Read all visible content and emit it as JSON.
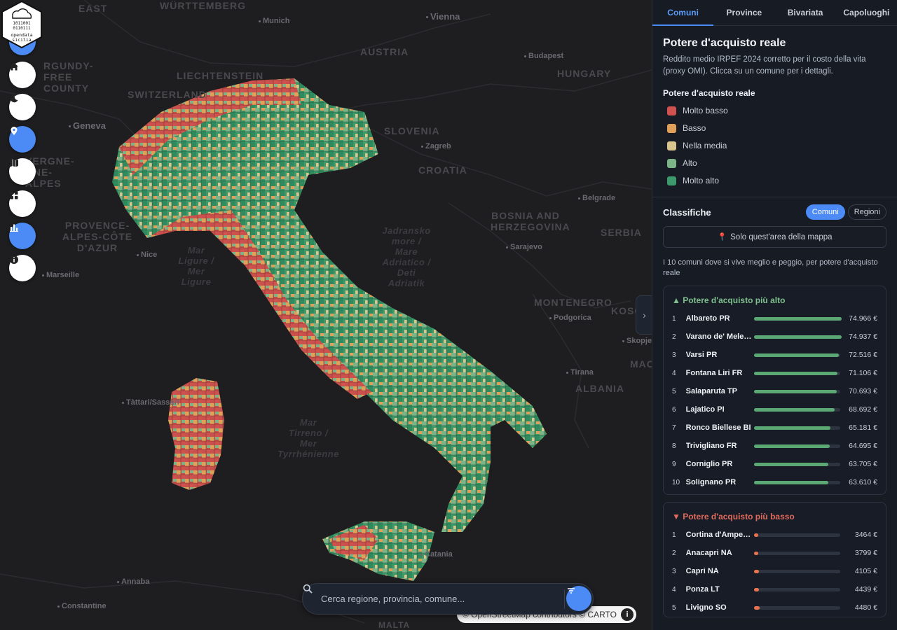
{
  "map": {
    "countries": [
      "AUSTRIA",
      "HUNGARY",
      "SLOVENIA",
      "CROATIA",
      "BOSNIA AND HERZEGOVINA",
      "SERBIA",
      "MONTENEGRO",
      "ALBANIA",
      "SWITZERLAND",
      "LIECHTENSTEIN",
      "WÜRTTEMBERG",
      "EAST"
    ],
    "regions": [
      "PROVENCE-ALPES-CÔTE D'AZUR",
      "RGUNDY-FREE COUNTY",
      "VERGNE-ÔNE-ALPES",
      "KOSO",
      "MAC"
    ],
    "cities": [
      "Munich",
      "Vienna",
      "Budapest",
      "Zagreb",
      "Geneva",
      "Nice",
      "Marseille",
      "Sarajevo",
      "Belgrade",
      "Podgorica",
      "Tirana",
      "Skopje",
      "Annaba",
      "Constantine",
      "Catania",
      "Tàttari/Sassari"
    ],
    "seas": [
      {
        "lines": [
          "Mar",
          "Ligure /",
          "Mer",
          "Ligure"
        ]
      },
      {
        "lines": [
          "Jadransko",
          "more /",
          "Mare",
          "Adriatico /",
          "Deti",
          "Adriatik"
        ]
      },
      {
        "lines": [
          "Mar",
          "Tirreno /",
          "Mer",
          "Tyrrhénienne"
        ]
      }
    ],
    "attribution": "© OpenStreetMap contributors © CARTO",
    "malta": "MALTA"
  },
  "toolbar": {
    "buttons": [
      {
        "name": "menu-button",
        "icon": "menu-icon",
        "active": true
      },
      {
        "name": "home-button",
        "icon": "home-icon",
        "active": false
      },
      {
        "name": "dark-mode-button",
        "icon": "moon-icon",
        "active": false
      },
      {
        "name": "location-button",
        "icon": "location-pin-icon",
        "active": true
      },
      {
        "name": "map-layers-button",
        "icon": "map-icon",
        "active": false
      },
      {
        "name": "grid-view-button",
        "icon": "grid-icon",
        "active": false
      },
      {
        "name": "charts-button",
        "icon": "bar-chart-icon",
        "active": true
      },
      {
        "name": "info-button",
        "icon": "info-icon",
        "active": false
      }
    ]
  },
  "search": {
    "placeholder": "Cerca regione, provincia, comune..."
  },
  "sidebar": {
    "tabs": [
      {
        "label": "Comuni",
        "active": true
      },
      {
        "label": "Province",
        "active": false
      },
      {
        "label": "Bivariata",
        "active": false
      },
      {
        "label": "Capoluoghi",
        "active": false
      }
    ],
    "title": "Potere d'acquisto reale",
    "description": "Reddito medio IRPEF 2024 corretto per il costo della vita (proxy OMI). Clicca su un comune per i dettagli.",
    "legend": {
      "title": "Potere d'acquisto reale",
      "items": [
        {
          "label": "Molto basso",
          "color": "#d0524f"
        },
        {
          "label": "Basso",
          "color": "#e0a05a"
        },
        {
          "label": "Nella media",
          "color": "#d9c68f"
        },
        {
          "label": "Alto",
          "color": "#7db487"
        },
        {
          "label": "Molto alto",
          "color": "#3d9a6c"
        }
      ]
    },
    "rankings": {
      "title": "Classifiche",
      "pills": [
        {
          "label": "Comuni",
          "active": true
        },
        {
          "label": "Regioni",
          "active": false
        }
      ],
      "area_button": "Solo quest'area della mappa",
      "subtitle": "I 10 comuni dove si vive meglio e peggio, per potere d'acquisto reale",
      "top": {
        "title": "▲ Potere d'acquisto più alto",
        "color": "#5ba874",
        "items": [
          {
            "rank": "1",
            "name": "Albareto PR",
            "value": "74.966 €",
            "pct": 1.0
          },
          {
            "rank": "2",
            "name": "Varano de' Melegari PR",
            "value": "74.937 €",
            "pct": 0.999
          },
          {
            "rank": "3",
            "name": "Varsi PR",
            "value": "72.516 €",
            "pct": 0.967
          },
          {
            "rank": "4",
            "name": "Fontana Liri FR",
            "value": "71.106 €",
            "pct": 0.948
          },
          {
            "rank": "5",
            "name": "Salaparuta TP",
            "value": "70.693 €",
            "pct": 0.943
          },
          {
            "rank": "6",
            "name": "Lajatico PI",
            "value": "68.692 €",
            "pct": 0.916
          },
          {
            "rank": "7",
            "name": "Ronco Biellese BI",
            "value": "65.181 €",
            "pct": 0.869
          },
          {
            "rank": "8",
            "name": "Trivigliano FR",
            "value": "64.695 €",
            "pct": 0.863
          },
          {
            "rank": "9",
            "name": "Corniglio PR",
            "value": "63.705 €",
            "pct": 0.85
          },
          {
            "rank": "10",
            "name": "Solignano PR",
            "value": "63.610 €",
            "pct": 0.848
          }
        ]
      },
      "bottom": {
        "title": "▼ Potere d'acquisto più basso",
        "color": "#e8734f",
        "items": [
          {
            "rank": "1",
            "name": "Cortina d'Ampezzo BL",
            "value": "3464 €",
            "pct": 0.046
          },
          {
            "rank": "2",
            "name": "Anacapri NA",
            "value": "3799 €",
            "pct": 0.051
          },
          {
            "rank": "3",
            "name": "Capri NA",
            "value": "4105 €",
            "pct": 0.055
          },
          {
            "rank": "4",
            "name": "Ponza LT",
            "value": "4439 €",
            "pct": 0.059
          },
          {
            "rank": "5",
            "name": "Livigno SO",
            "value": "4480 €",
            "pct": 0.06
          }
        ]
      }
    }
  }
}
